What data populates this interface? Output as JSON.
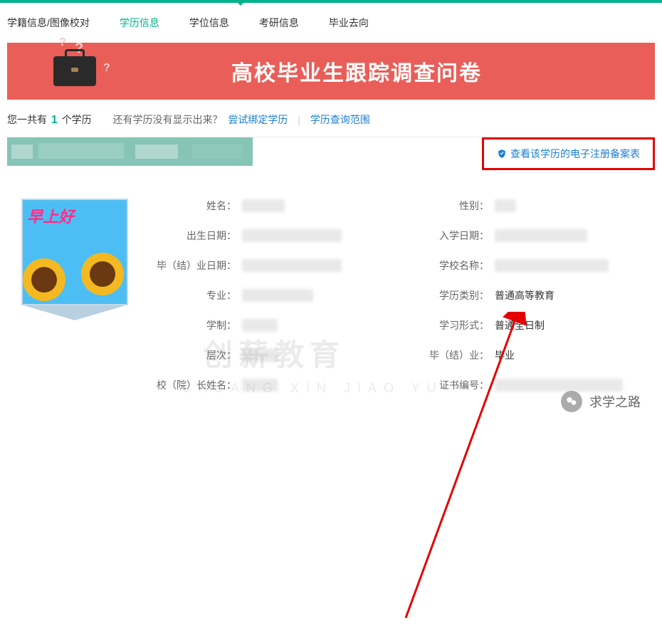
{
  "tabs": [
    {
      "label": "学籍信息/图像校对",
      "active": false
    },
    {
      "label": "学历信息",
      "active": true
    },
    {
      "label": "学位信息",
      "active": false
    },
    {
      "label": "考研信息",
      "active": false
    },
    {
      "label": "毕业去向",
      "active": false
    }
  ],
  "banner": {
    "title": "高校毕业生跟踪调查问卷"
  },
  "count_row": {
    "prefix": "您一共有",
    "count": "1",
    "suffix": "个学历",
    "hint": "还有学历没有显示出来？",
    "bind_link": "尝试绑定学历",
    "divider": "|",
    "scope_link": "学历查询范围"
  },
  "action": {
    "label": "查看该学历的电子注册备案表"
  },
  "photo": {
    "greeting": "早上好"
  },
  "fields": {
    "name_label": "姓名：",
    "gender_label": "性别：",
    "birth_label": "出生日期：",
    "enroll_label": "入学日期：",
    "grad_date_label": "毕（结）业日期：",
    "school_label": "学校名称：",
    "major_label": "专业：",
    "edu_type_label": "学历类别：",
    "edu_type_value": "普通高等教育",
    "system_label": "学制：",
    "study_mode_label": "学习形式：",
    "study_mode_value": "普通全日制",
    "level_label": "层次：",
    "grad_status_label": "毕（结）业：",
    "grad_status_value": "毕业",
    "president_label": "校（院）长姓名：",
    "cert_no_label": "证书编号："
  },
  "watermarks": {
    "main": "创薪教育",
    "sub": "CHUANG XIN JIAO YU",
    "footer": "求学之路"
  }
}
